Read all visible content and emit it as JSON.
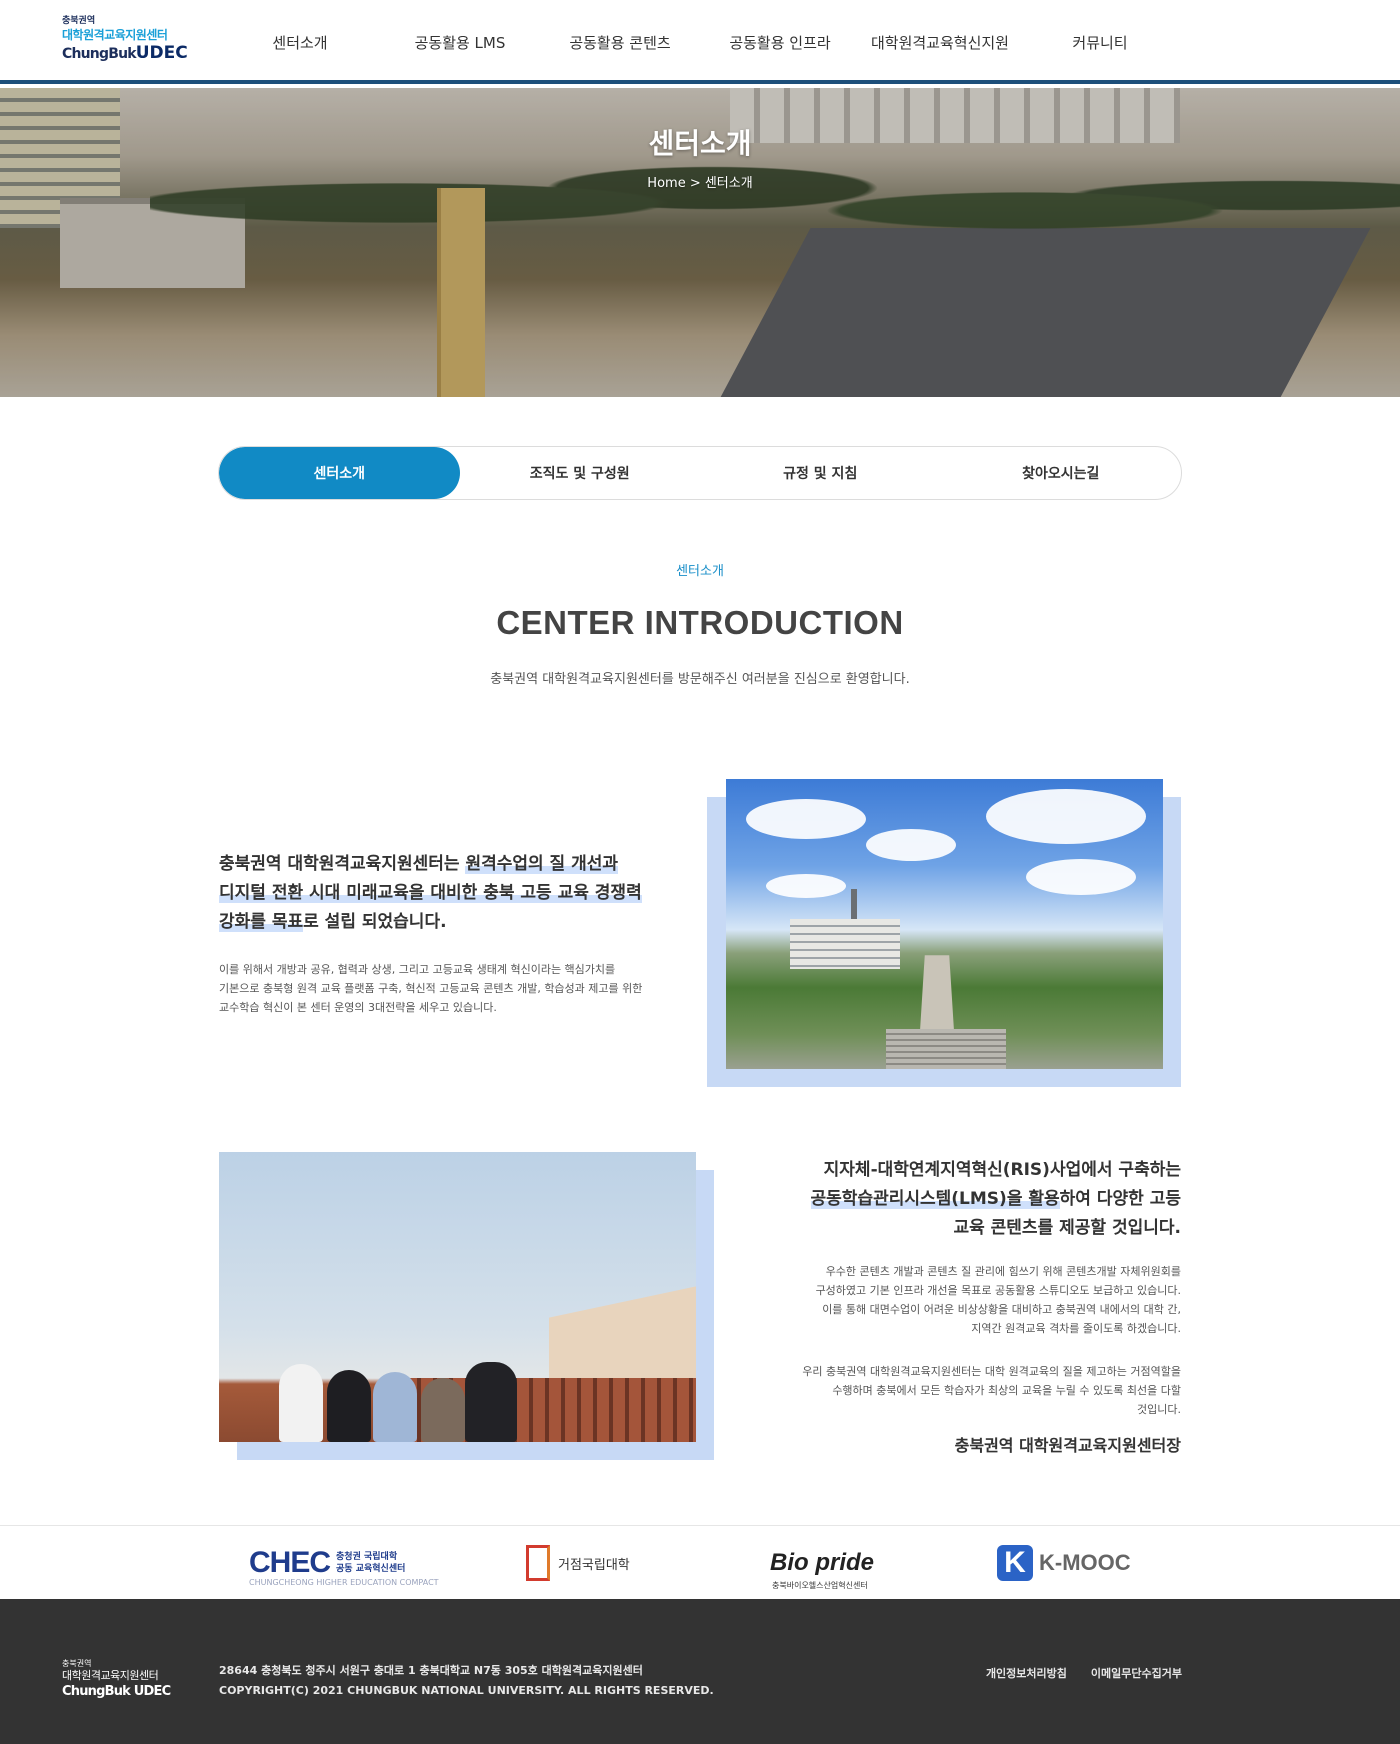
{
  "header": {
    "logo": {
      "line1": "충북권역",
      "line2": "대학원격교육지원센터",
      "line3_prefix": "ChungBuk",
      "line3_brand": "UDEC"
    },
    "nav": [
      "센터소개",
      "공동활용 LMS",
      "공동활용 콘텐츠",
      "공동활용 인프라",
      "대학원격교육혁신지원",
      "커뮤니티"
    ]
  },
  "hero": {
    "title": "센터소개",
    "breadcrumb": "Home > 센터소개"
  },
  "tabs": {
    "items": [
      "센터소개",
      "조직도 및 구성원",
      "규정 및 지침",
      "찾아오시는길"
    ],
    "active_index": 0
  },
  "section": {
    "eyebrow": "센터소개",
    "title": "CENTER INTRODUCTION",
    "subtitle": "충북권역 대학원격교육지원센터를 방문해주신 여러분을 진심으로 환영합니다."
  },
  "block1": {
    "heading": {
      "line1_plain": "충북권역 대학원격교육지원센터는 ",
      "line1_hl": "원격수업의 질 개선과",
      "line2_hl": "디지털 전환 시대 미래교육을 대비한 충북 고등 교육 경쟁력",
      "line3_hl": "강화를 목표",
      "line3_plain": "로 설립 되었습니다."
    },
    "body": [
      "이를 위해서 개방과 공유, 협력과 상생, 그리고 고등교육 생태계 혁신이라는 핵심가치를",
      "기본으로 충북형 원격 교육 플랫폼 구축, 혁신적 고등교육 콘텐츠 개발, 학습성과 제고를 위한",
      "교수학습 혁신이 본 센터 운영의 3대전략을 세우고 있습니다."
    ]
  },
  "block2": {
    "heading": {
      "line1": "지자체-대학연계지역혁신(RIS)사업에서 구축하는",
      "line2_hl": "공동학습관리시스템(LMS)을 활용",
      "line2_plain": "하여 다양한 고등",
      "line3": "교육 콘텐츠를 제공할 것입니다."
    },
    "body1": [
      "우수한 콘텐츠 개발과 콘텐츠 질 관리에 힘쓰기 위해 콘텐츠개발 자체위원회를",
      "구성하였고 기본 인프라 개선을 목표로 공동활용 스튜디오도 보급하고 있습니다.",
      "이를 통해 대면수업이 어려운 비상상황을 대비하고 충북권역 내에서의 대학 간,",
      "지역간 원격교육 격차를 줄이도록 하겠습니다."
    ],
    "body2": [
      "우리 충북권역 대학원격교육지원센터는 대학 원격교육의 질을 제고하는 거점역할을",
      "수행하며 충북에서 모든 학습자가 최상의 교육을 누릴 수 있도록 최선을 다할",
      "것입니다."
    ],
    "signature": "충북권역 대학원격교육지원센터장"
  },
  "partners": {
    "chec": {
      "big": "CHEC",
      "small1": "충청권 국립대학",
      "small2": "공동 교육혁신센터",
      "sub": "CHUNGCHEONG HIGHER EDUCATION COMPACT"
    },
    "geojeom": {
      "text": "거점국립대학"
    },
    "biopride": {
      "text": "Bio pride",
      "sub": "충북바이오헬스산업혁신센터"
    },
    "kmooc": {
      "k": "K",
      "text": "K-MOOC"
    }
  },
  "footer": {
    "logo": {
      "line1": "충북권역",
      "line2": "대학원격교육지원센터",
      "line3": "ChungBuk UDEC"
    },
    "address": "28644 충청북도 청주시 서원구 충대로 1 충북대학교 N7동 305호 대학원격교육지원센터",
    "copyright": "COPYRIGHT(C) 2021 CHUNGBUK NATIONAL UNIVERSITY. ALL RIGHTS RESERVED.",
    "links": [
      "개인정보처리방침",
      "이메일무단수집거부"
    ]
  },
  "colors": {
    "accent": "#118ac5",
    "header_border": "#1d4f7a",
    "highlight": "#cfe0fb",
    "photo_shadow": "#c7d9f5",
    "footer_bg": "#333333"
  }
}
